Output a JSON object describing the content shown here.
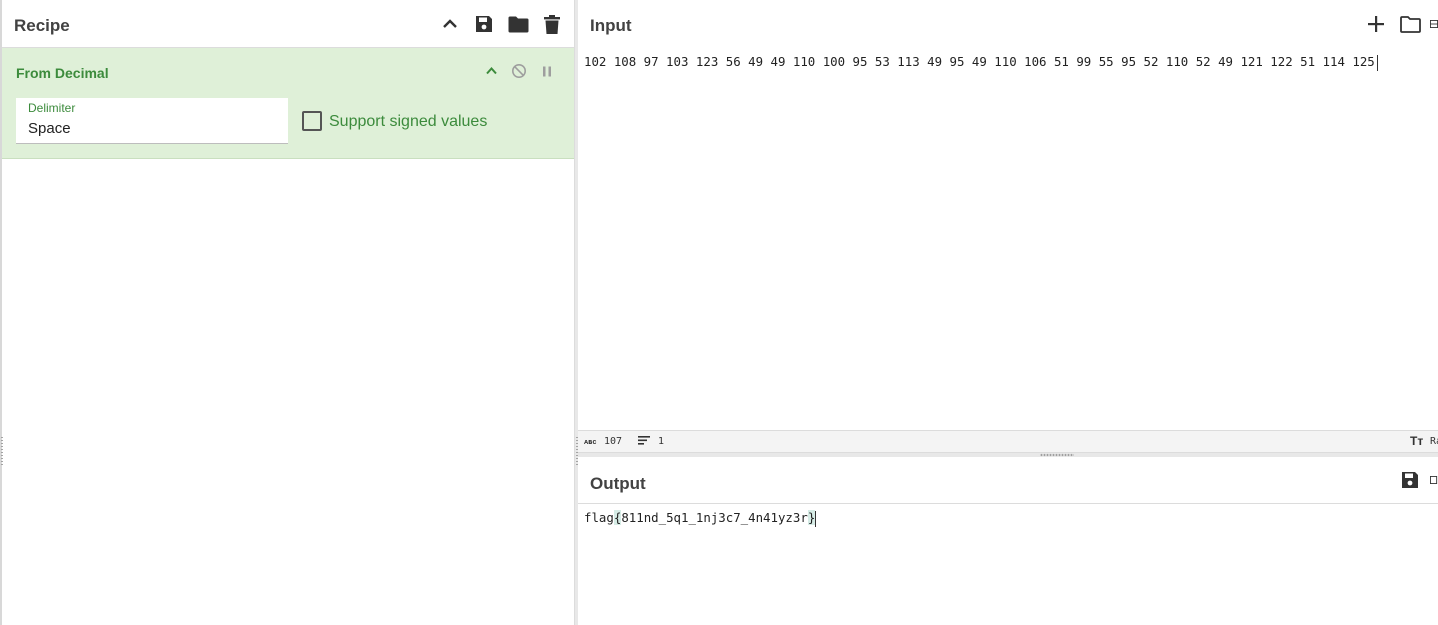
{
  "recipe": {
    "title": "Recipe",
    "actions": [
      "collapse-all",
      "save",
      "load",
      "clear"
    ]
  },
  "operation": {
    "name": "From Decimal",
    "delimiter_label": "Delimiter",
    "delimiter_value": "Space",
    "signed_label": "Support signed values",
    "signed_checked": false
  },
  "input": {
    "title": "Input",
    "text": "102 108 97 103 123 56 49 49 110 100 95 53 113 49 95 49 110 106 51 99 55 95 52 110 52 49 121 122 51 114 125",
    "length": "107",
    "lines": "1",
    "status_right": "Ra"
  },
  "output": {
    "title": "Output",
    "text_before": "flag",
    "brace_open": "{",
    "text_middle": "811nd_5q1_1nj3c7_4n41yz3r",
    "brace_close": "}"
  },
  "colors": {
    "accent_green": "#3c8b3c",
    "card_bg": "#dff0d8",
    "header_text": "#424242"
  }
}
